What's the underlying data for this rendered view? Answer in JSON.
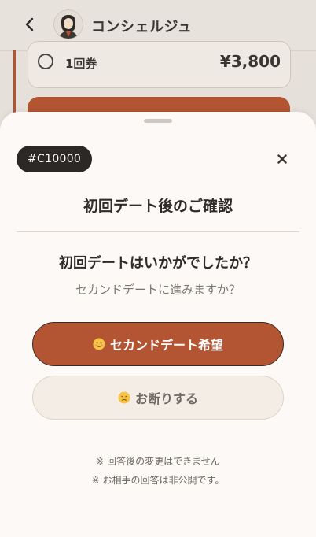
{
  "header": {
    "title": "コンシェルジュ",
    "back_icon": "chevron-left-icon"
  },
  "plan": {
    "name": "1回券",
    "price": "¥3,800"
  },
  "sheet": {
    "code": "#C10000",
    "title": "初回デート後のご確認",
    "question": "初回デートはいかがでしたか？",
    "subquestion": "セカンドデートに進みますか？",
    "primary_label": "セカンドデート希望",
    "secondary_label": "お断りする",
    "note1": "※ 回答後の変更はできません",
    "note2": "※ お相手の回答は非公開です。",
    "close_icon": "close-icon"
  },
  "colors": {
    "accent": "#b35532",
    "badge": "#2c2825",
    "secondary_bg": "#f3ede6"
  }
}
